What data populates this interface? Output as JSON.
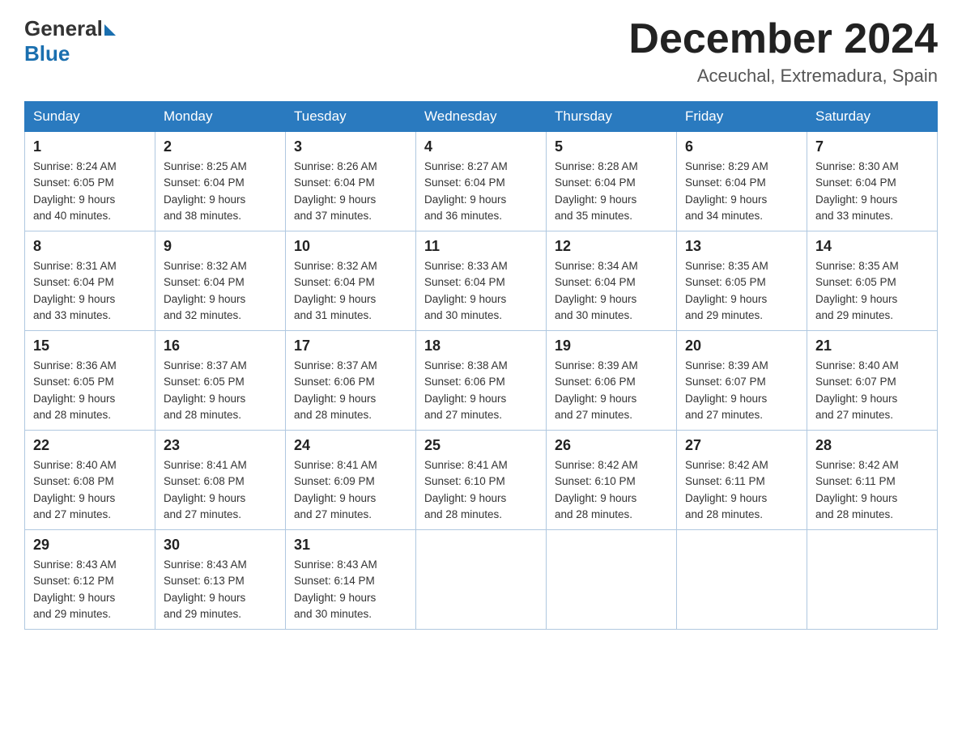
{
  "header": {
    "logo_general": "General",
    "logo_blue": "Blue",
    "month_title": "December 2024",
    "location": "Aceuchal, Extremadura, Spain"
  },
  "weekdays": [
    "Sunday",
    "Monday",
    "Tuesday",
    "Wednesday",
    "Thursday",
    "Friday",
    "Saturday"
  ],
  "weeks": [
    [
      {
        "day": "1",
        "sunrise": "8:24 AM",
        "sunset": "6:05 PM",
        "daylight": "9 hours and 40 minutes."
      },
      {
        "day": "2",
        "sunrise": "8:25 AM",
        "sunset": "6:04 PM",
        "daylight": "9 hours and 38 minutes."
      },
      {
        "day": "3",
        "sunrise": "8:26 AM",
        "sunset": "6:04 PM",
        "daylight": "9 hours and 37 minutes."
      },
      {
        "day": "4",
        "sunrise": "8:27 AM",
        "sunset": "6:04 PM",
        "daylight": "9 hours and 36 minutes."
      },
      {
        "day": "5",
        "sunrise": "8:28 AM",
        "sunset": "6:04 PM",
        "daylight": "9 hours and 35 minutes."
      },
      {
        "day": "6",
        "sunrise": "8:29 AM",
        "sunset": "6:04 PM",
        "daylight": "9 hours and 34 minutes."
      },
      {
        "day": "7",
        "sunrise": "8:30 AM",
        "sunset": "6:04 PM",
        "daylight": "9 hours and 33 minutes."
      }
    ],
    [
      {
        "day": "8",
        "sunrise": "8:31 AM",
        "sunset": "6:04 PM",
        "daylight": "9 hours and 33 minutes."
      },
      {
        "day": "9",
        "sunrise": "8:32 AM",
        "sunset": "6:04 PM",
        "daylight": "9 hours and 32 minutes."
      },
      {
        "day": "10",
        "sunrise": "8:32 AM",
        "sunset": "6:04 PM",
        "daylight": "9 hours and 31 minutes."
      },
      {
        "day": "11",
        "sunrise": "8:33 AM",
        "sunset": "6:04 PM",
        "daylight": "9 hours and 30 minutes."
      },
      {
        "day": "12",
        "sunrise": "8:34 AM",
        "sunset": "6:04 PM",
        "daylight": "9 hours and 30 minutes."
      },
      {
        "day": "13",
        "sunrise": "8:35 AM",
        "sunset": "6:05 PM",
        "daylight": "9 hours and 29 minutes."
      },
      {
        "day": "14",
        "sunrise": "8:35 AM",
        "sunset": "6:05 PM",
        "daylight": "9 hours and 29 minutes."
      }
    ],
    [
      {
        "day": "15",
        "sunrise": "8:36 AM",
        "sunset": "6:05 PM",
        "daylight": "9 hours and 28 minutes."
      },
      {
        "day": "16",
        "sunrise": "8:37 AM",
        "sunset": "6:05 PM",
        "daylight": "9 hours and 28 minutes."
      },
      {
        "day": "17",
        "sunrise": "8:37 AM",
        "sunset": "6:06 PM",
        "daylight": "9 hours and 28 minutes."
      },
      {
        "day": "18",
        "sunrise": "8:38 AM",
        "sunset": "6:06 PM",
        "daylight": "9 hours and 27 minutes."
      },
      {
        "day": "19",
        "sunrise": "8:39 AM",
        "sunset": "6:06 PM",
        "daylight": "9 hours and 27 minutes."
      },
      {
        "day": "20",
        "sunrise": "8:39 AM",
        "sunset": "6:07 PM",
        "daylight": "9 hours and 27 minutes."
      },
      {
        "day": "21",
        "sunrise": "8:40 AM",
        "sunset": "6:07 PM",
        "daylight": "9 hours and 27 minutes."
      }
    ],
    [
      {
        "day": "22",
        "sunrise": "8:40 AM",
        "sunset": "6:08 PM",
        "daylight": "9 hours and 27 minutes."
      },
      {
        "day": "23",
        "sunrise": "8:41 AM",
        "sunset": "6:08 PM",
        "daylight": "9 hours and 27 minutes."
      },
      {
        "day": "24",
        "sunrise": "8:41 AM",
        "sunset": "6:09 PM",
        "daylight": "9 hours and 27 minutes."
      },
      {
        "day": "25",
        "sunrise": "8:41 AM",
        "sunset": "6:10 PM",
        "daylight": "9 hours and 28 minutes."
      },
      {
        "day": "26",
        "sunrise": "8:42 AM",
        "sunset": "6:10 PM",
        "daylight": "9 hours and 28 minutes."
      },
      {
        "day": "27",
        "sunrise": "8:42 AM",
        "sunset": "6:11 PM",
        "daylight": "9 hours and 28 minutes."
      },
      {
        "day": "28",
        "sunrise": "8:42 AM",
        "sunset": "6:11 PM",
        "daylight": "9 hours and 28 minutes."
      }
    ],
    [
      {
        "day": "29",
        "sunrise": "8:43 AM",
        "sunset": "6:12 PM",
        "daylight": "9 hours and 29 minutes."
      },
      {
        "day": "30",
        "sunrise": "8:43 AM",
        "sunset": "6:13 PM",
        "daylight": "9 hours and 29 minutes."
      },
      {
        "day": "31",
        "sunrise": "8:43 AM",
        "sunset": "6:14 PM",
        "daylight": "9 hours and 30 minutes."
      },
      null,
      null,
      null,
      null
    ]
  ],
  "labels": {
    "sunrise": "Sunrise:",
    "sunset": "Sunset:",
    "daylight": "Daylight:"
  }
}
